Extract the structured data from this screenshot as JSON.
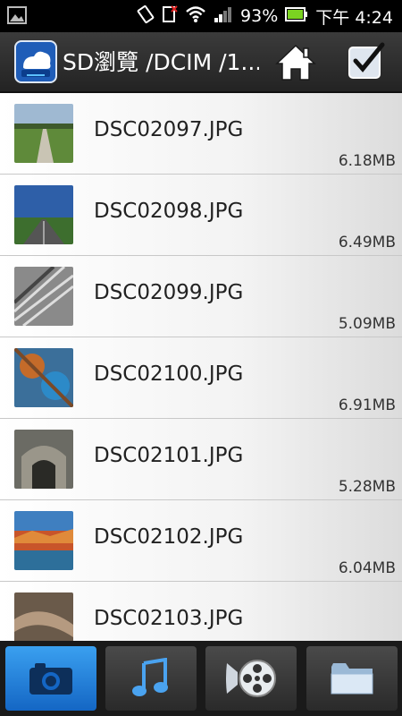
{
  "status": {
    "battery": "93%",
    "time": "下午 4:24"
  },
  "header": {
    "title": "SD瀏覽 /DCIM /1..."
  },
  "files": [
    {
      "name": "DSC02097.JPG",
      "size": "6.18MB"
    },
    {
      "name": "DSC02098.JPG",
      "size": "6.49MB"
    },
    {
      "name": "DSC02099.JPG",
      "size": "5.09MB"
    },
    {
      "name": "DSC02100.JPG",
      "size": "6.91MB"
    },
    {
      "name": "DSC02101.JPG",
      "size": "5.28MB"
    },
    {
      "name": "DSC02102.JPG",
      "size": "6.04MB"
    },
    {
      "name": "DSC02103.JPG",
      "size": ""
    }
  ],
  "tabs": [
    {
      "icon": "camera-icon",
      "active": true
    },
    {
      "icon": "music-note-icon",
      "active": false
    },
    {
      "icon": "film-reel-icon",
      "active": false
    },
    {
      "icon": "folder-icon",
      "active": false
    }
  ],
  "colors": {
    "accent": "#1e7fe0",
    "toolbar": "#2b2b2b"
  }
}
